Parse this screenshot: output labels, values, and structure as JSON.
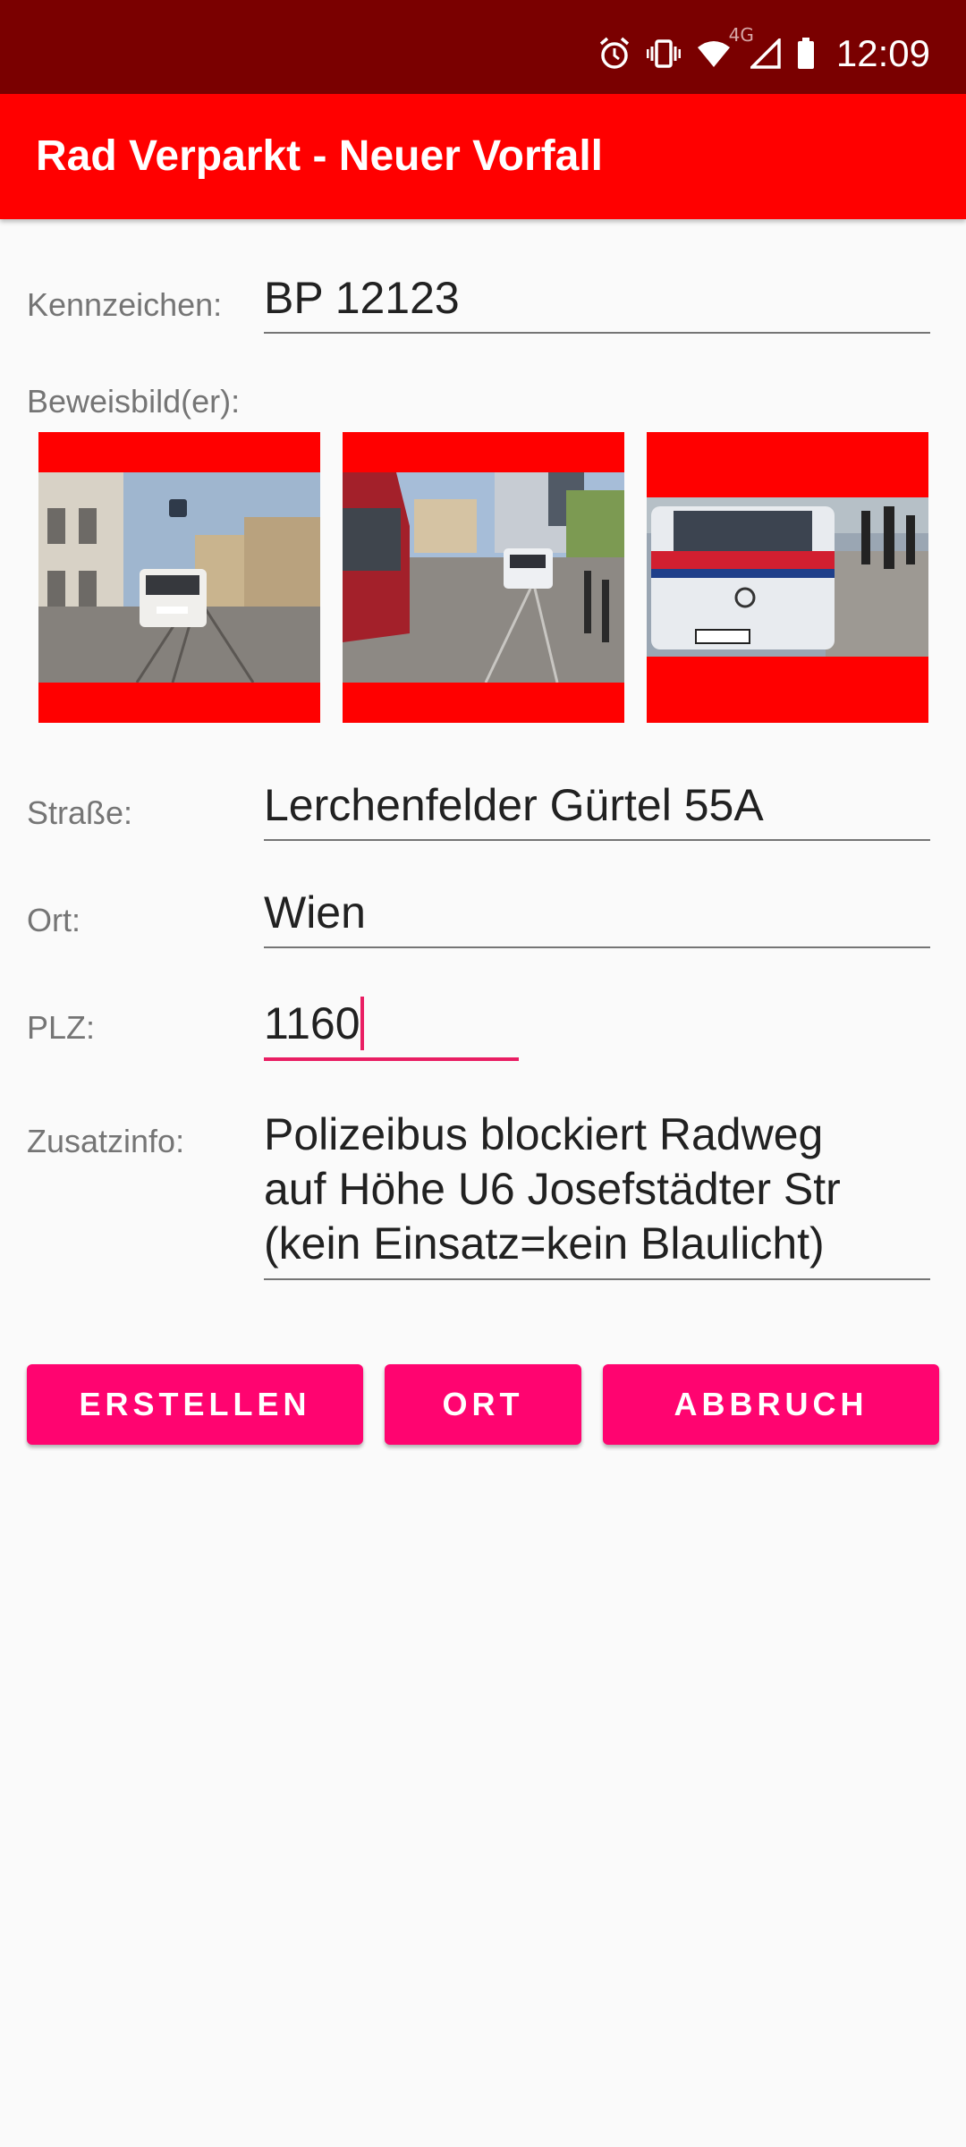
{
  "status_bar": {
    "time": "12:09",
    "network_label": "4G",
    "icons": [
      "alarm-icon",
      "vibrate-icon",
      "wifi-icon",
      "cell-signal-icon",
      "battery-icon"
    ]
  },
  "app_bar": {
    "title": "Rad Verparkt - Neuer Vorfall"
  },
  "form": {
    "kennzeichen": {
      "label": "Kennzeichen:",
      "value": "BP 12123"
    },
    "beweisbilder": {
      "label": "Beweisbild(er):",
      "images": [
        {
          "alt": "Street scene with car parked on tram tracks"
        },
        {
          "alt": "Tram and police car on street"
        },
        {
          "alt": "Police van blocking bike lane"
        }
      ]
    },
    "strasse": {
      "label": "Straße:",
      "value": "Lerchenfelder Gürtel 55A"
    },
    "ort": {
      "label": "Ort:",
      "value": "Wien"
    },
    "plz": {
      "label": "PLZ:",
      "value": "1160"
    },
    "zusatzinfo": {
      "label": "Zusatzinfo:",
      "lines": [
        "Polizeibus blockiert Radweg",
        "auf Höhe U6 Josefstädter Str",
        "(kein Einsatz=kein Blaulicht)"
      ]
    }
  },
  "buttons": {
    "erstellen": "ERSTELLEN",
    "ort": "ORT",
    "abbruch": "ABBRUCH"
  },
  "colors": {
    "status_bar": "#7a0000",
    "app_bar": "#ff0000",
    "accent": "#ff0470",
    "focus_underline": "#e91e63"
  }
}
